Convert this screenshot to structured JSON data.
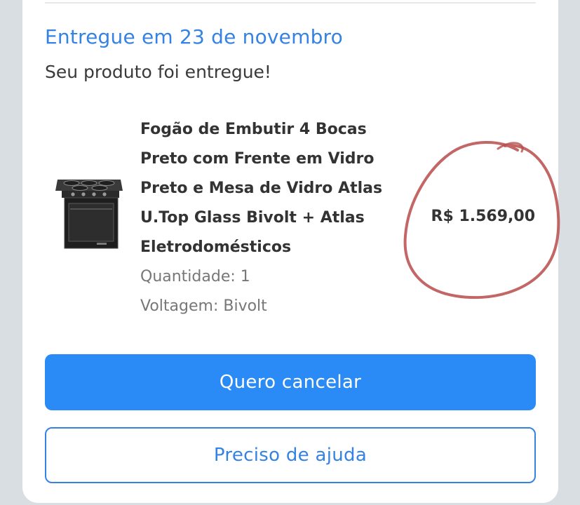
{
  "delivery": {
    "title": "Entregue em 23 de novembro",
    "subtitle": "Seu produto foi entregue!"
  },
  "product": {
    "title": "Fogão de Embutir 4 Bocas Preto com Frente em Vidro Preto e Mesa de Vidro Atlas U.Top Glass Bivolt + Atlas Eletrodomésticos",
    "quantity": "Quantidade: 1",
    "voltage": "Voltagem: Bivolt",
    "price": "R$ 1.569,00"
  },
  "actions": {
    "cancel_label": "Quero cancelar",
    "help_label": "Preciso de ajuda"
  },
  "colors": {
    "accent": "#3483e4",
    "primary_button": "#2a8af6",
    "annotation_circle": "#b84b4b"
  }
}
